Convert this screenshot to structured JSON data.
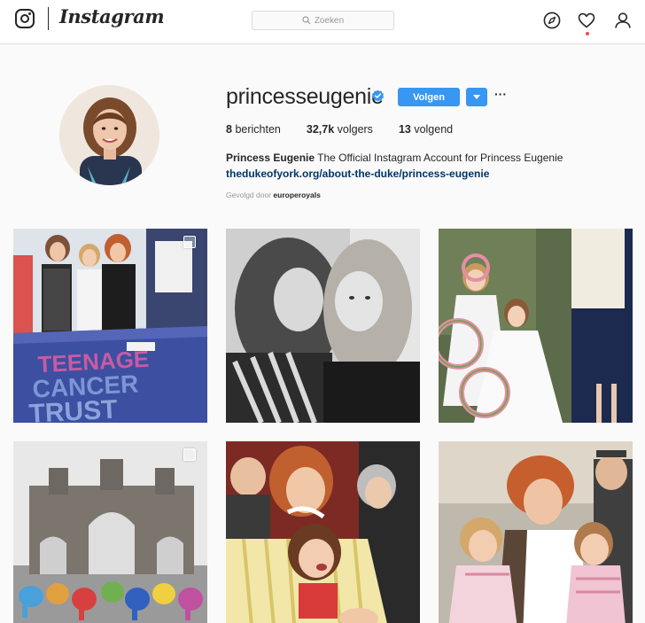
{
  "nav": {
    "brand": "Instagram",
    "search_placeholder": "Zoeken",
    "icons": [
      "instagram-logo-icon",
      "explore-compass-icon",
      "activity-heart-icon",
      "profile-person-icon"
    ]
  },
  "profile": {
    "username": "princesseugenie",
    "verified": true,
    "follow_label": "Volgen",
    "stats": {
      "posts_count": "8",
      "posts_label": "berichten",
      "followers_count": "32,7k",
      "followers_label": "volgers",
      "following_count": "13",
      "following_label": "volgend"
    },
    "full_name": "Princess Eugenie",
    "bio": "The Official Instagram Account for Princess Eugenie",
    "website": "thedukeofyork.org/about-the-duke/princess-eugenie",
    "followed_by_label": "Gevolgd door",
    "followed_by_user": "europeroyals"
  },
  "posts": [
    {
      "caption_visible": "TEENAGE CANCER TRUST",
      "multi": true
    },
    {
      "multi": false
    },
    {
      "multi": false
    },
    {
      "multi": true
    },
    {
      "multi": false
    },
    {
      "multi": false
    }
  ],
  "colors": {
    "accent_blue": "#3897f0",
    "link_blue": "#003569",
    "notification_red": "#ed4956",
    "background": "#fafafa"
  }
}
